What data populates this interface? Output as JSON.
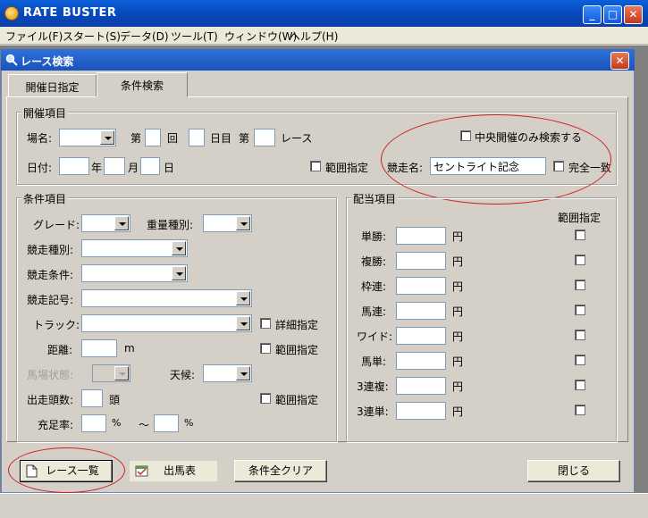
{
  "app": {
    "title": "RATE BUSTER"
  },
  "menu": [
    "ファイル(F)",
    "スタート(S)",
    "データ(D)",
    "ツール(T)",
    "ウィンドウ(W)",
    "ヘルプ(H)"
  ],
  "window": {
    "title": "レース検索"
  },
  "tabs": [
    {
      "label": "開催日指定",
      "active": false
    },
    {
      "label": "条件検索",
      "active": true
    }
  ],
  "kaisai": {
    "legend": "開催項目",
    "place_label": "場名:",
    "dai": "第",
    "kai": "回",
    "nichime": "日目",
    "dai2": "第",
    "race": "レース",
    "date_label": "日付:",
    "year": "年",
    "month": "月",
    "day": "日",
    "range_label": "範囲指定",
    "central_only": "中央開催のみ検索する",
    "race_name_label": "競走名:",
    "race_name_value": "セントライト記念",
    "exact_match": "完全一致"
  },
  "conditions": {
    "legend": "条件項目",
    "grade": "グレード:",
    "weight_type": "重量種別:",
    "race_type": "競走種別:",
    "race_condition": "競走条件:",
    "race_symbol": "競走記号:",
    "track": "トラック:",
    "detail_spec": "詳細指定",
    "distance": "距離:",
    "distance_unit": "m",
    "range1": "範囲指定",
    "going": "馬場状態:",
    "weather": "天候:",
    "runners": "出走頭数:",
    "runners_unit": "頭",
    "range2": "範囲指定",
    "fill_rate": "充足率:",
    "pct1": "%",
    "tilde": "～",
    "pct2": "%"
  },
  "payout": {
    "legend": "配当項目",
    "range_header": "範囲指定",
    "yen": "円",
    "rows": [
      "単勝:",
      "複勝:",
      "枠連:",
      "馬連:",
      "ワイド:",
      "馬単:",
      "3連複:",
      "3連単:"
    ]
  },
  "buttons": {
    "race_list": "レース一覧",
    "entries": "出馬表",
    "clear_all": "条件全クリア",
    "close": "閉じる"
  }
}
